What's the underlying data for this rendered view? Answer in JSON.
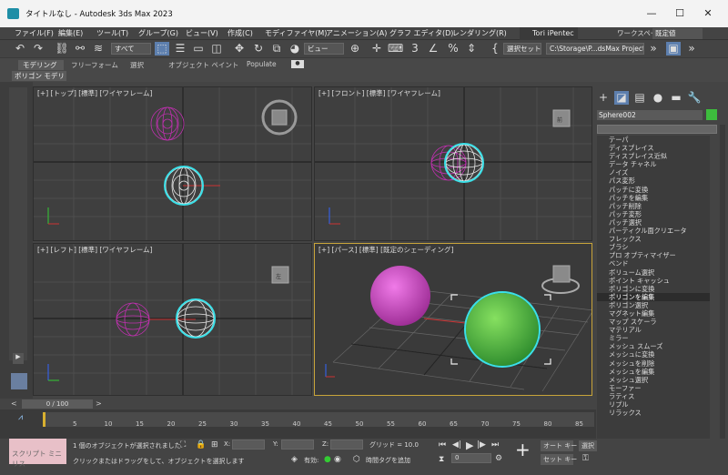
{
  "window": {
    "title": "タイトルなし - Autodesk 3ds Max 2023",
    "min": "—",
    "max": "☐",
    "close": "✕"
  },
  "menu": [
    "ファイル(F)",
    "編集(E)",
    "ツール(T)",
    "グループ(G)",
    "ビュー(V)",
    "作成(C)",
    "モディファイヤ(M)",
    "アニメーション(A)",
    "グラフ エディタ(D)",
    "レンダリング(R)"
  ],
  "user": "Tori iPentec",
  "workspace": {
    "label": "ワークスペース:",
    "value": "既定値"
  },
  "toolbar": {
    "filter": "すべて",
    "refcoord": "ビュー",
    "selset": "選択セット作成",
    "project": "C:\\Storage\\P...dsMax Project"
  },
  "ribbon": {
    "tabs": [
      "モデリング",
      "フリーフォーム",
      "選択",
      "オブジェクト ペイント",
      "Populate"
    ],
    "sub": "ポリゴン モデリング"
  },
  "viewports": [
    {
      "label": "[+] [トップ] [標準] [ワイヤフレーム]"
    },
    {
      "label": "[+] [フロント] [標準] [ワイヤフレーム]"
    },
    {
      "label": "[+] [レフト] [標準] [ワイヤフレーム]"
    },
    {
      "label": "[+] [パース] [標準] [既定のシェーディング]"
    }
  ],
  "viewcube": {
    "left": "左",
    "front": "前"
  },
  "command_panel": {
    "object_name": "Sphere002",
    "object_color": "#3dbd3d",
    "modifiers": [
      "テーパ",
      "ディスプレイス",
      "ディスプレイス近似",
      "データ チャネル",
      "ノイズ",
      "パス変形",
      "パッチに変換",
      "パッチを編集",
      "パッチ削除",
      "パッチ変形",
      "パッチ選択",
      "パーティクル面クリエータ",
      "フレックス",
      "ブラシ",
      "プロ オプティマイザー",
      "ベンド",
      "ボリューム選択",
      "ポイント キャッシュ",
      "ポリゴンに変換",
      "ポリゴンを編集",
      "ポリゴン選択",
      "マグネット編集",
      "マップ スケーラ",
      "マテリアル",
      "ミラー",
      "メッシュ スムーズ",
      "メッシュに変換",
      "メッシュを削除",
      "メッシュを編集",
      "メッシュ選択",
      "モーファー",
      "ラティス",
      "リプル",
      "リラックス"
    ],
    "selected_modifier": "ポリゴンを編集"
  },
  "time": {
    "slider": "0 / 100",
    "ticks": [
      "0",
      "5",
      "10",
      "15",
      "20",
      "25",
      "30",
      "35",
      "40",
      "45",
      "50",
      "55",
      "60",
      "65",
      "70",
      "75",
      "80",
      "85"
    ]
  },
  "status": {
    "miniscript": "スクリプト ミニ リス",
    "selected": "1 個のオブジェクトが選択されました",
    "prompt": "クリックまたはドラッグをして、オブジェクトを選択します",
    "x": "X:",
    "y": "Y:",
    "z": "Z:",
    "grid": "グリッド = 10.0",
    "enabled": "有効:",
    "add_tag": "時間タグを追加",
    "autokey": "オート キー",
    "setkey": "セット キー",
    "selection": "選択",
    "frame": "0"
  }
}
